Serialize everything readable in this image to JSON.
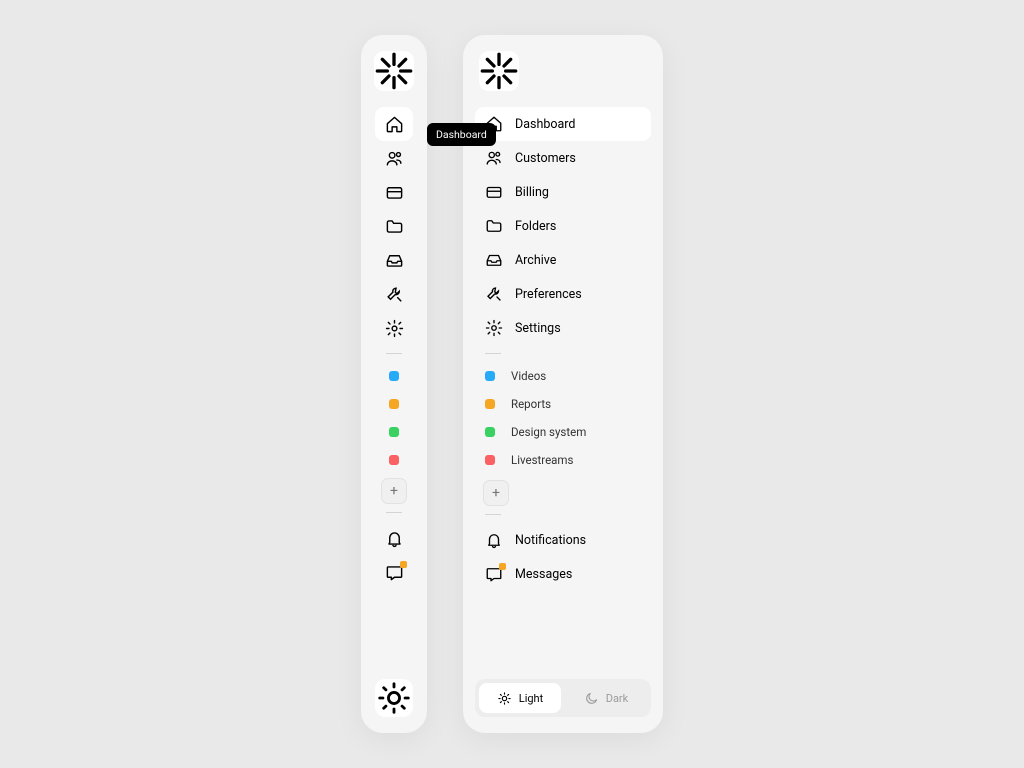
{
  "tooltip": "Dashboard",
  "nav": [
    {
      "label": "Dashboard"
    },
    {
      "label": "Customers"
    },
    {
      "label": "Billing"
    },
    {
      "label": "Folders"
    },
    {
      "label": "Archive"
    },
    {
      "label": "Preferences"
    },
    {
      "label": "Settings"
    }
  ],
  "tags": [
    {
      "label": "Videos"
    },
    {
      "label": "Reports"
    },
    {
      "label": "Design system"
    },
    {
      "label": "Livestreams"
    }
  ],
  "add_label": "+",
  "footer": [
    {
      "label": "Notifications"
    },
    {
      "label": "Messages"
    }
  ],
  "theme": {
    "light": "Light",
    "dark": "Dark"
  }
}
